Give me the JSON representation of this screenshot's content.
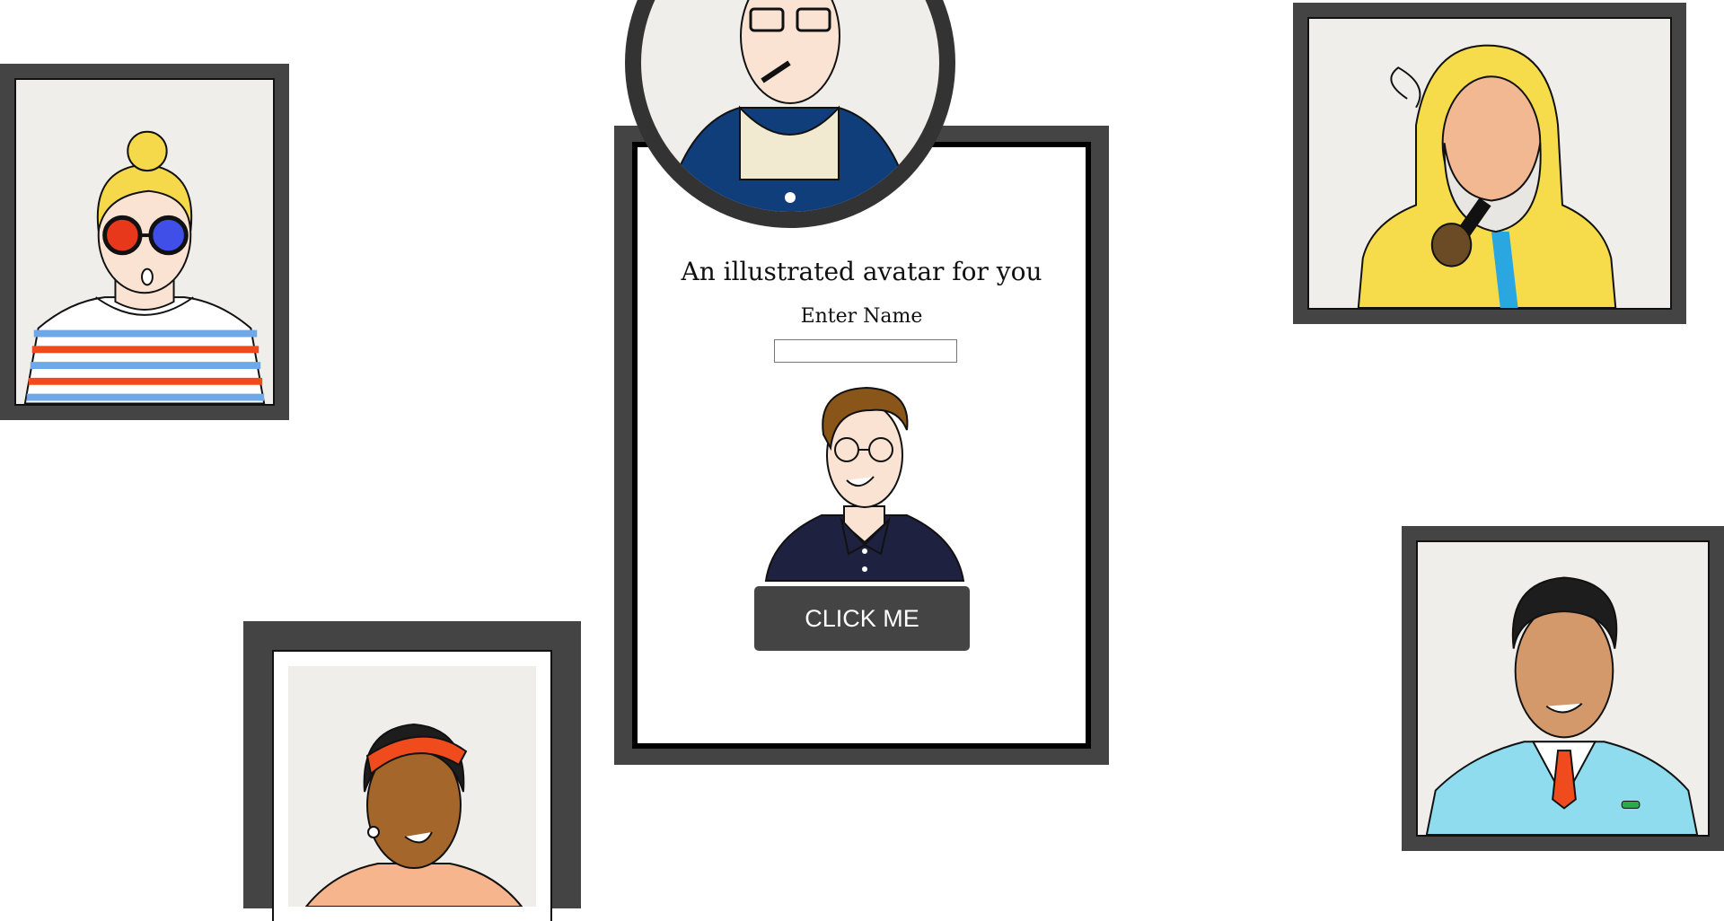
{
  "card": {
    "title": "An illustrated avatar for you",
    "name_label": "Enter Name",
    "name_value": "",
    "button_label": "CLICK ME"
  },
  "colors": {
    "frame": "#444444",
    "canvas": "#f0eeea",
    "button": "#444444"
  },
  "icons": [
    "avatar-blonde-woman-3d-glasses",
    "avatar-redhead-man-cigarette",
    "avatar-fisherman-pipe",
    "avatar-brown-hair-man-glasses",
    "avatar-woman-headscarf",
    "avatar-man-blue-sweater"
  ]
}
